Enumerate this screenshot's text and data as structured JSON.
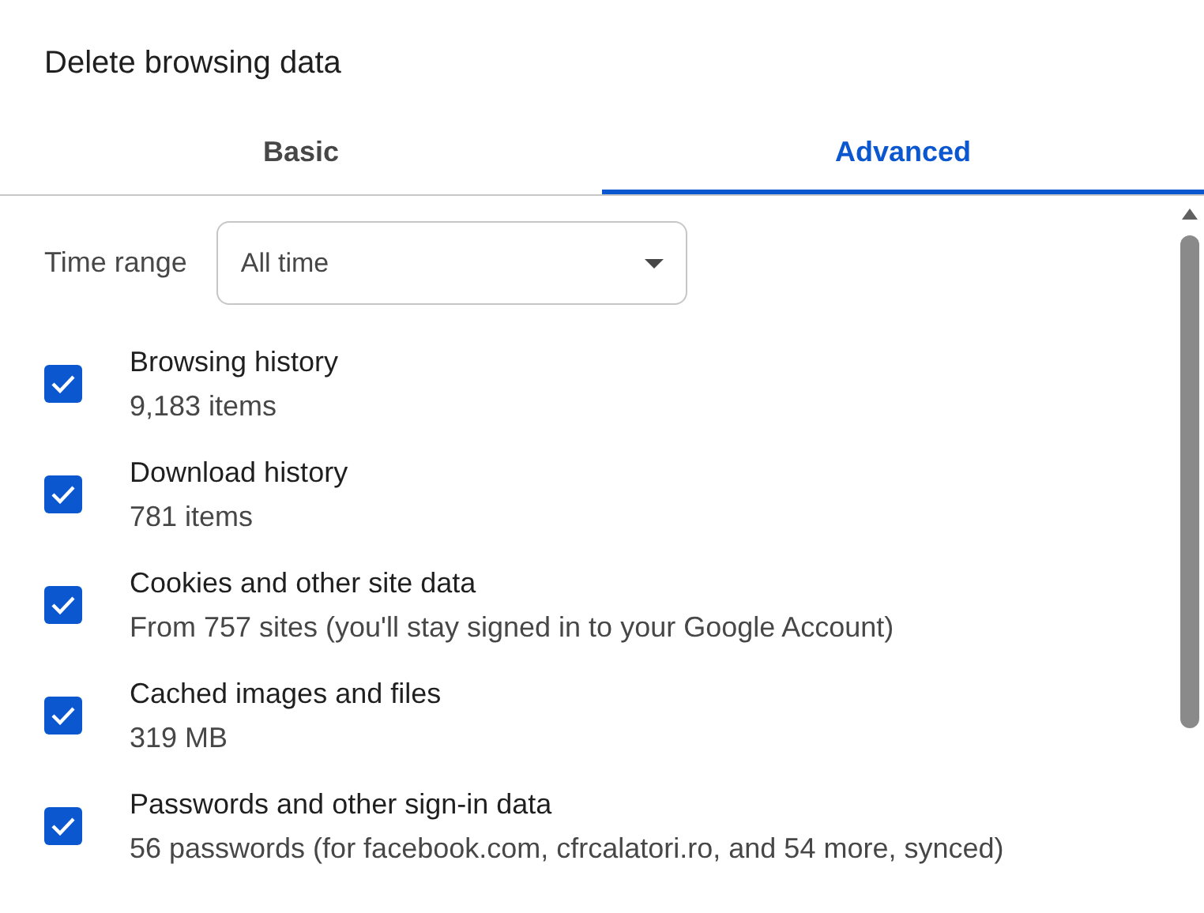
{
  "dialog": {
    "title": "Delete browsing data"
  },
  "tabs": [
    {
      "label": "Basic",
      "selected": false
    },
    {
      "label": "Advanced",
      "selected": true
    }
  ],
  "time_range": {
    "label": "Time range",
    "value": "All time"
  },
  "items": [
    {
      "title": "Browsing history",
      "detail": "9,183 items",
      "checked": true
    },
    {
      "title": "Download history",
      "detail": "781 items",
      "checked": true
    },
    {
      "title": "Cookies and other site data",
      "detail": "From 757 sites (you'll stay signed in to your Google Account)",
      "checked": true
    },
    {
      "title": "Cached images and files",
      "detail": "319 MB",
      "checked": true
    },
    {
      "title": "Passwords and other sign-in data",
      "detail": "56 passwords (for facebook.com, cfrcalatori.ro, and 54 more, synced)",
      "checked": true
    }
  ]
}
